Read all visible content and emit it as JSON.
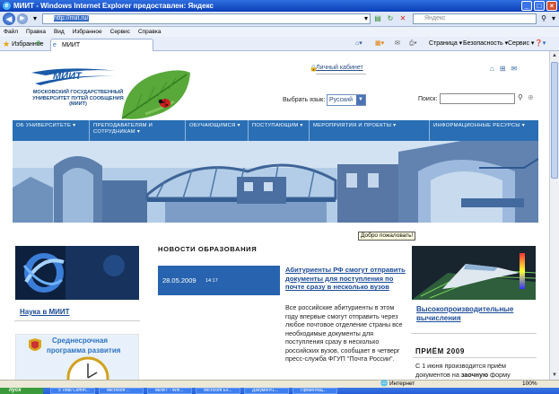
{
  "window": {
    "title": "МИИТ - Windows Internet Explorer предоставлен: Яндекс"
  },
  "address_bar": {
    "url": "http://miit.ru/",
    "search_placeholder": "Яндекс"
  },
  "menu": [
    "Файл",
    "Правка",
    "Вид",
    "Избранное",
    "Сервис",
    "Справка"
  ],
  "favorites_bar": {
    "favorites_label": "Избранное",
    "tab_title": "МИИТ",
    "commands": [
      "Страница ▾",
      "Безопасность ▾",
      "Сервис ▾"
    ]
  },
  "site": {
    "logo_text_lines": [
      "МОСКОВСКИЙ ГОСУДАРСТВЕННЫЙ",
      "УНИВЕРСИТЕТ ПУТЕЙ СООБЩЕНИЯ",
      "(МИИТ)"
    ],
    "logo_word": "МИИТ",
    "personal_cabinet": "Личный кабинет",
    "language_label": "Выбрать язык:",
    "language_value": "Русский",
    "search_label": "Поиск:",
    "nav": [
      "ОБ УНИВЕРСИТЕТЕ ▾",
      "ПРЕПОДАВАТЕЛЯМ И СОТРУДНИКАМ ▾",
      "ОБУЧАЮЩИМСЯ ▾",
      "ПОСТУПАЮЩИМ ▾",
      "МЕРОПРИЯТИЯ И ПРОЕКТЫ ▾",
      "ИНФОРМАЦИОННЫЕ РЕСУРСЫ ▾"
    ],
    "tooltip": "Добро пожаловать!",
    "left": {
      "link": "Наука в МИИТ",
      "program_lines": [
        "Среднесрочная",
        "программа развития"
      ]
    },
    "news": {
      "heading": "НОВОСТИ ОБРАЗОВАНИЯ",
      "date": "28.05.2009",
      "time": "14:17",
      "title": "Абитуриенты РФ смогут отправить документы для поступления по почте сразу в несколько вузов",
      "body": "Все российские абитуриенты в этом году впервые смогут отправить через любое почтовое отделение страны все необходимые документы для поступления сразу в несколько российских вузов, сообщает в четверг пресс-служба ФГУП \"Почта России\"."
    },
    "right": {
      "link": "Высокопроизводительные вычисления",
      "admission_heading": "ПРИЁМ 2009",
      "admission_text_before": "С 1 июня производится приём документов на ",
      "admission_bold": "заочную",
      "admission_text_after": " форму"
    }
  },
  "status_bar": {
    "zone": "Интернет",
    "zoom": "100%"
  },
  "taskbar": {
    "start": "пуск",
    "tasks": [
      "5 Total Comm...",
      "Microsoft ...",
      "МИИТ - Win...",
      "Microsoft Ex...",
      "Документ1...",
      "Презентац..."
    ]
  }
}
